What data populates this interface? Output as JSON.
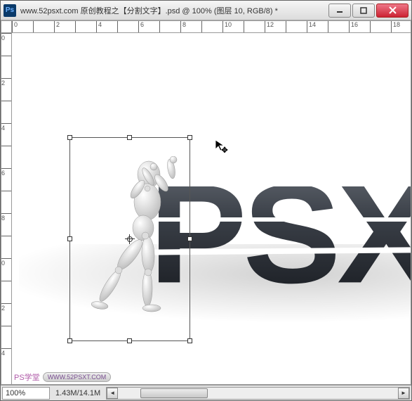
{
  "titlebar": {
    "title": "www.52psxt.com 原创教程之【分割文字】.psd @ 100% (图层 10, RGB/8) *",
    "app_abbrev": "Ps"
  },
  "win_buttons": {
    "minimize": "minimize",
    "maximize": "maximize",
    "close": "close"
  },
  "ruler_h_ticks": [
    "0",
    "",
    "2",
    "",
    "4",
    "",
    "6",
    "",
    "8",
    "",
    "10",
    "",
    "12",
    "",
    "14",
    "",
    "16",
    "",
    "18"
  ],
  "ruler_v_ticks": [
    "0",
    "",
    "2",
    "",
    "4",
    "",
    "6",
    "",
    "8",
    "",
    "0",
    "",
    "2",
    "",
    "4"
  ],
  "canvas": {
    "big_text": "PSX"
  },
  "status": {
    "zoom": "100%",
    "doc_size": "1.43M/14.1M"
  },
  "watermark": {
    "label": "PS学堂",
    "url": "WWW.52PSXT.COM"
  }
}
